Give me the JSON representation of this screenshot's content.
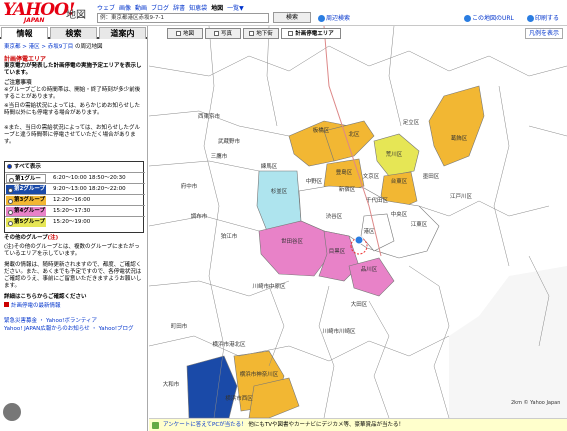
{
  "header": {
    "logo": "YAHOO!",
    "logo_sub": "JAPAN",
    "logo_map": "地図",
    "services": [
      "ウェブ",
      "画像",
      "動画",
      "ブログ",
      "辞書",
      "知恵袋",
      "地図",
      "一覧▼"
    ],
    "active_service": "地図",
    "search_value": "例：東京都港区赤坂9-7-1",
    "search_button": "検索",
    "around_link": "周辺検索",
    "url_link": "この地図のURL",
    "print_link": "印刷する"
  },
  "sidebar": {
    "tabs": [
      "情報",
      "検索",
      "道案内"
    ],
    "breadcrumb": [
      "東京都",
      "港区",
      "赤坂9丁目"
    ],
    "breadcrumb_tail": "の周辺地図",
    "section_title": "計画停電エリア",
    "intro": "東京電力が発表した計画停電の実施予定エリアを表示しています。",
    "notes_title": "ご注意事項",
    "notes": [
      "※グループごとの時間帯は、開始・終了時刻が多少前後することがあります。",
      "※当日の需給状況によっては、あらかじめお知らせした時間以外にも停電する場合があります。",
      "※また、当日の需給状況によっては、お知らせしたグループと違う時間帯に停電させていただく場合があります。"
    ],
    "groups_all": "すべて表示",
    "groups": [
      {
        "label": "第1グループ",
        "time": "6:20〜10:00 18:50〜20:30",
        "color": "#ffffff"
      },
      {
        "label": "第2グループ",
        "time": "9:20〜13:00 18:20〜22:00",
        "color": "#1a4aa8"
      },
      {
        "label": "第3グループ",
        "time": "12:20〜16:00",
        "color": "#f2b733"
      },
      {
        "label": "第4グループ",
        "time": "15:20〜17:30",
        "color": "#e882c8"
      },
      {
        "label": "第5グループ",
        "time": "15:20〜19:00",
        "color": "#e6e655"
      }
    ],
    "other_groups": "その他のグループ",
    "other_groups_note": "(注)",
    "other_note": "(注)その他のグループとは、複数のグループにまたがっているエリアを示しています。",
    "disclaimer": "掲載の情報は、随時更新されますので、都度、ご確認ください。また、あくまでも予定ですので、各停電状況はご確認のうえ、事前にご留意いただきますようお願いします。",
    "details_title": "詳細はこちらからご確認ください",
    "details_link": "計画停電の最新情報",
    "links": [
      "緊急災害募金 ・ Yahoo!ボランティア",
      "Yahoo! JAPAN広報からのお知らせ ・ Yahoo!ブログ"
    ]
  },
  "map": {
    "tabs": [
      "地図",
      "写真",
      "地下街",
      "計画停電エリア"
    ],
    "active_tab": "計画停電エリア",
    "legend_link": "凡例を表示",
    "labels": [
      {
        "name": "板橋区"
      },
      {
        "name": "北区"
      },
      {
        "name": "足立区"
      },
      {
        "name": "葛飾区"
      },
      {
        "name": "荒川区"
      },
      {
        "name": "豊島区"
      },
      {
        "name": "練馬区"
      },
      {
        "name": "文京区"
      },
      {
        "name": "台東区"
      },
      {
        "name": "墨田区"
      },
      {
        "name": "江戸川区"
      },
      {
        "name": "中野区"
      },
      {
        "name": "新宿区"
      },
      {
        "name": "杉並区"
      },
      {
        "name": "千代田区"
      },
      {
        "name": "中央区"
      },
      {
        "name": "渋谷区"
      },
      {
        "name": "江東区"
      },
      {
        "name": "港区"
      },
      {
        "name": "世田谷区"
      },
      {
        "name": "目黒区"
      },
      {
        "name": "品川区"
      },
      {
        "name": "大田区"
      },
      {
        "name": "川崎市中原区"
      },
      {
        "name": "川崎市川崎区"
      },
      {
        "name": "横浜市神奈川区"
      },
      {
        "name": "横浜市西区"
      },
      {
        "name": "三鷹市"
      },
      {
        "name": "武蔵野市"
      },
      {
        "name": "調布市"
      },
      {
        "name": "狛江市"
      },
      {
        "name": "町田市"
      },
      {
        "name": "大和市"
      },
      {
        "name": "府中市"
      },
      {
        "name": "西東京市"
      },
      {
        "name": "横浜市港北区"
      }
    ],
    "copyright": "© Yahoo Japan",
    "scale": "2km"
  },
  "bottom_bar": {
    "link": "アンケートに答えてPCが当たる！",
    "text": "他にもTVや図書やカーナビにデジカメ等、豪華賞品が当たる！"
  },
  "colors": {
    "group1": "#ffffff",
    "group2": "#1a4aa8",
    "group3": "#f2b733",
    "group4": "#e882c8",
    "group5": "#e6e655",
    "other": "#aee4ee"
  }
}
